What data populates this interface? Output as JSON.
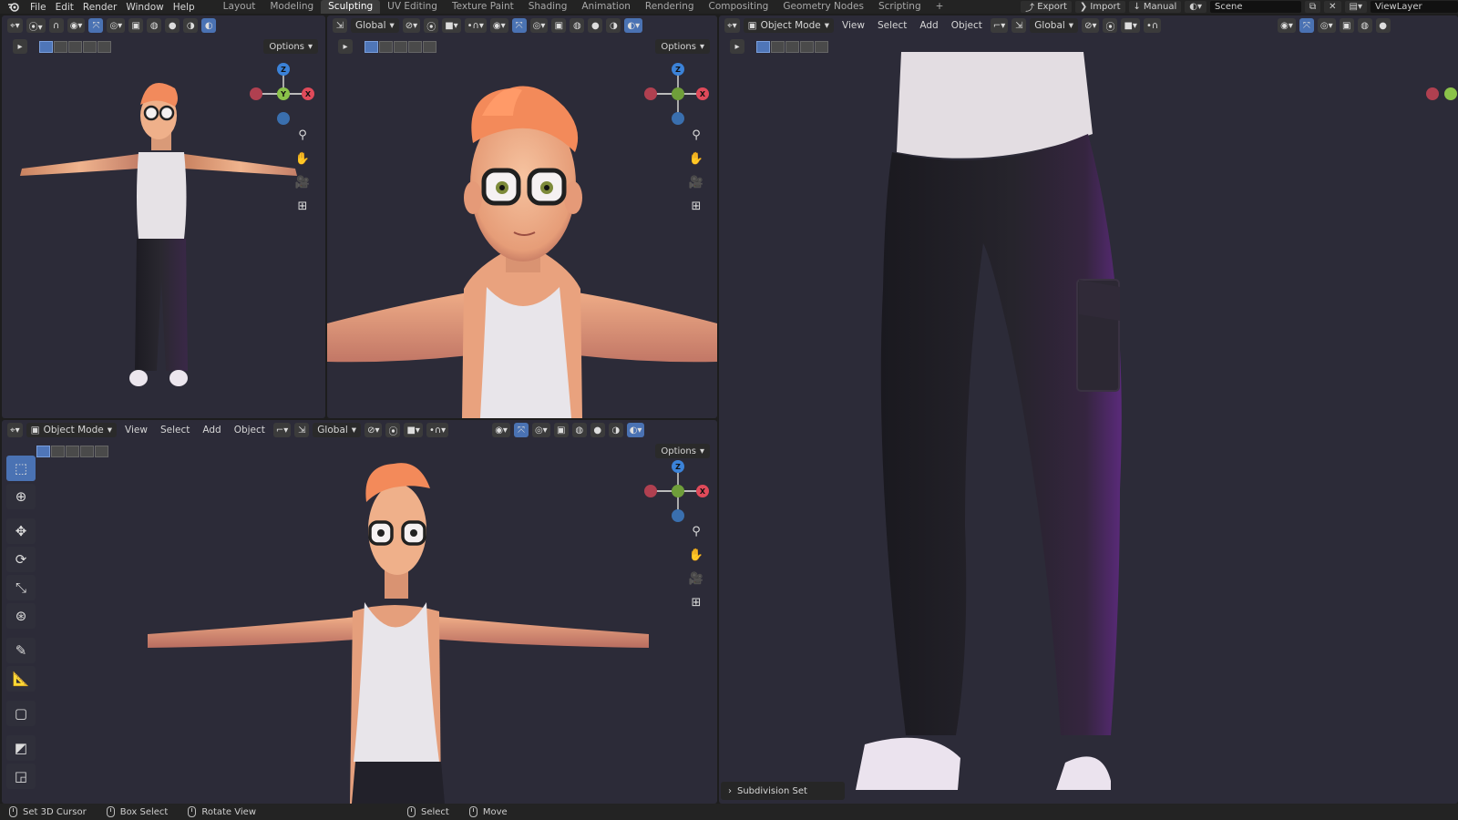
{
  "menu": [
    "File",
    "Edit",
    "Render",
    "Window",
    "Help"
  ],
  "workspaces": [
    {
      "label": "Layout",
      "active": false
    },
    {
      "label": "Modeling",
      "active": false
    },
    {
      "label": "Sculpting",
      "active": true
    },
    {
      "label": "UV Editing",
      "active": false
    },
    {
      "label": "Texture Paint",
      "active": false
    },
    {
      "label": "Shading",
      "active": false
    },
    {
      "label": "Animation",
      "active": false
    },
    {
      "label": "Rendering",
      "active": false
    },
    {
      "label": "Compositing",
      "active": false
    },
    {
      "label": "Geometry Nodes",
      "active": false
    },
    {
      "label": "Scripting",
      "active": false
    }
  ],
  "topright": {
    "export": "Export",
    "import": "Import",
    "manual": "Manual",
    "scene": "Scene",
    "view_layer": "ViewLayer"
  },
  "viewport_header": {
    "mode": "Object Mode",
    "view": "View",
    "select": "Select",
    "add": "Add",
    "object": "Object",
    "orientation": "Global",
    "options": "Options"
  },
  "axes": {
    "x": "X",
    "y": "Y",
    "z": "Z"
  },
  "panel_label": "Subdivision Set",
  "status": [
    {
      "label": "Set 3D Cursor"
    },
    {
      "label": "Box Select"
    },
    {
      "label": "Rotate View"
    },
    {
      "label": "Select"
    },
    {
      "label": "Move"
    }
  ],
  "colors": {
    "viewport_bg": "#2c2b38",
    "accent": "#4a72b3",
    "x_axis": "#e04a5a",
    "y_axis": "#8bc34a",
    "z_axis": "#3b82d8"
  }
}
